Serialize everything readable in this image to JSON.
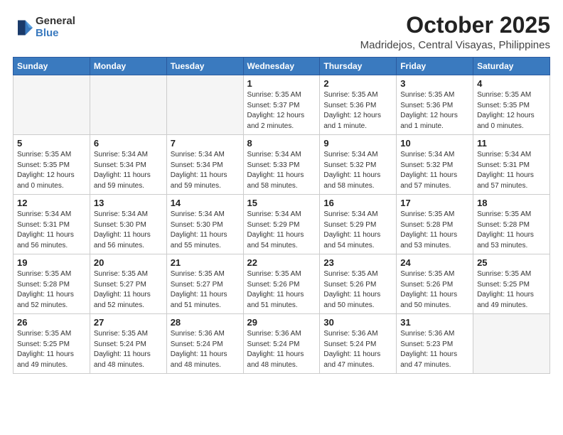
{
  "logo": {
    "general": "General",
    "blue": "Blue"
  },
  "title": "October 2025",
  "location": "Madridejos, Central Visayas, Philippines",
  "weekdays": [
    "Sunday",
    "Monday",
    "Tuesday",
    "Wednesday",
    "Thursday",
    "Friday",
    "Saturday"
  ],
  "weeks": [
    [
      {
        "day": "",
        "info": ""
      },
      {
        "day": "",
        "info": ""
      },
      {
        "day": "",
        "info": ""
      },
      {
        "day": "1",
        "info": "Sunrise: 5:35 AM\nSunset: 5:37 PM\nDaylight: 12 hours\nand 2 minutes."
      },
      {
        "day": "2",
        "info": "Sunrise: 5:35 AM\nSunset: 5:36 PM\nDaylight: 12 hours\nand 1 minute."
      },
      {
        "day": "3",
        "info": "Sunrise: 5:35 AM\nSunset: 5:36 PM\nDaylight: 12 hours\nand 1 minute."
      },
      {
        "day": "4",
        "info": "Sunrise: 5:35 AM\nSunset: 5:35 PM\nDaylight: 12 hours\nand 0 minutes."
      }
    ],
    [
      {
        "day": "5",
        "info": "Sunrise: 5:35 AM\nSunset: 5:35 PM\nDaylight: 12 hours\nand 0 minutes."
      },
      {
        "day": "6",
        "info": "Sunrise: 5:34 AM\nSunset: 5:34 PM\nDaylight: 11 hours\nand 59 minutes."
      },
      {
        "day": "7",
        "info": "Sunrise: 5:34 AM\nSunset: 5:34 PM\nDaylight: 11 hours\nand 59 minutes."
      },
      {
        "day": "8",
        "info": "Sunrise: 5:34 AM\nSunset: 5:33 PM\nDaylight: 11 hours\nand 58 minutes."
      },
      {
        "day": "9",
        "info": "Sunrise: 5:34 AM\nSunset: 5:32 PM\nDaylight: 11 hours\nand 58 minutes."
      },
      {
        "day": "10",
        "info": "Sunrise: 5:34 AM\nSunset: 5:32 PM\nDaylight: 11 hours\nand 57 minutes."
      },
      {
        "day": "11",
        "info": "Sunrise: 5:34 AM\nSunset: 5:31 PM\nDaylight: 11 hours\nand 57 minutes."
      }
    ],
    [
      {
        "day": "12",
        "info": "Sunrise: 5:34 AM\nSunset: 5:31 PM\nDaylight: 11 hours\nand 56 minutes."
      },
      {
        "day": "13",
        "info": "Sunrise: 5:34 AM\nSunset: 5:30 PM\nDaylight: 11 hours\nand 56 minutes."
      },
      {
        "day": "14",
        "info": "Sunrise: 5:34 AM\nSunset: 5:30 PM\nDaylight: 11 hours\nand 55 minutes."
      },
      {
        "day": "15",
        "info": "Sunrise: 5:34 AM\nSunset: 5:29 PM\nDaylight: 11 hours\nand 54 minutes."
      },
      {
        "day": "16",
        "info": "Sunrise: 5:34 AM\nSunset: 5:29 PM\nDaylight: 11 hours\nand 54 minutes."
      },
      {
        "day": "17",
        "info": "Sunrise: 5:35 AM\nSunset: 5:28 PM\nDaylight: 11 hours\nand 53 minutes."
      },
      {
        "day": "18",
        "info": "Sunrise: 5:35 AM\nSunset: 5:28 PM\nDaylight: 11 hours\nand 53 minutes."
      }
    ],
    [
      {
        "day": "19",
        "info": "Sunrise: 5:35 AM\nSunset: 5:28 PM\nDaylight: 11 hours\nand 52 minutes."
      },
      {
        "day": "20",
        "info": "Sunrise: 5:35 AM\nSunset: 5:27 PM\nDaylight: 11 hours\nand 52 minutes."
      },
      {
        "day": "21",
        "info": "Sunrise: 5:35 AM\nSunset: 5:27 PM\nDaylight: 11 hours\nand 51 minutes."
      },
      {
        "day": "22",
        "info": "Sunrise: 5:35 AM\nSunset: 5:26 PM\nDaylight: 11 hours\nand 51 minutes."
      },
      {
        "day": "23",
        "info": "Sunrise: 5:35 AM\nSunset: 5:26 PM\nDaylight: 11 hours\nand 50 minutes."
      },
      {
        "day": "24",
        "info": "Sunrise: 5:35 AM\nSunset: 5:26 PM\nDaylight: 11 hours\nand 50 minutes."
      },
      {
        "day": "25",
        "info": "Sunrise: 5:35 AM\nSunset: 5:25 PM\nDaylight: 11 hours\nand 49 minutes."
      }
    ],
    [
      {
        "day": "26",
        "info": "Sunrise: 5:35 AM\nSunset: 5:25 PM\nDaylight: 11 hours\nand 49 minutes."
      },
      {
        "day": "27",
        "info": "Sunrise: 5:35 AM\nSunset: 5:24 PM\nDaylight: 11 hours\nand 48 minutes."
      },
      {
        "day": "28",
        "info": "Sunrise: 5:36 AM\nSunset: 5:24 PM\nDaylight: 11 hours\nand 48 minutes."
      },
      {
        "day": "29",
        "info": "Sunrise: 5:36 AM\nSunset: 5:24 PM\nDaylight: 11 hours\nand 48 minutes."
      },
      {
        "day": "30",
        "info": "Sunrise: 5:36 AM\nSunset: 5:24 PM\nDaylight: 11 hours\nand 47 minutes."
      },
      {
        "day": "31",
        "info": "Sunrise: 5:36 AM\nSunset: 5:23 PM\nDaylight: 11 hours\nand 47 minutes."
      },
      {
        "day": "",
        "info": ""
      }
    ]
  ]
}
